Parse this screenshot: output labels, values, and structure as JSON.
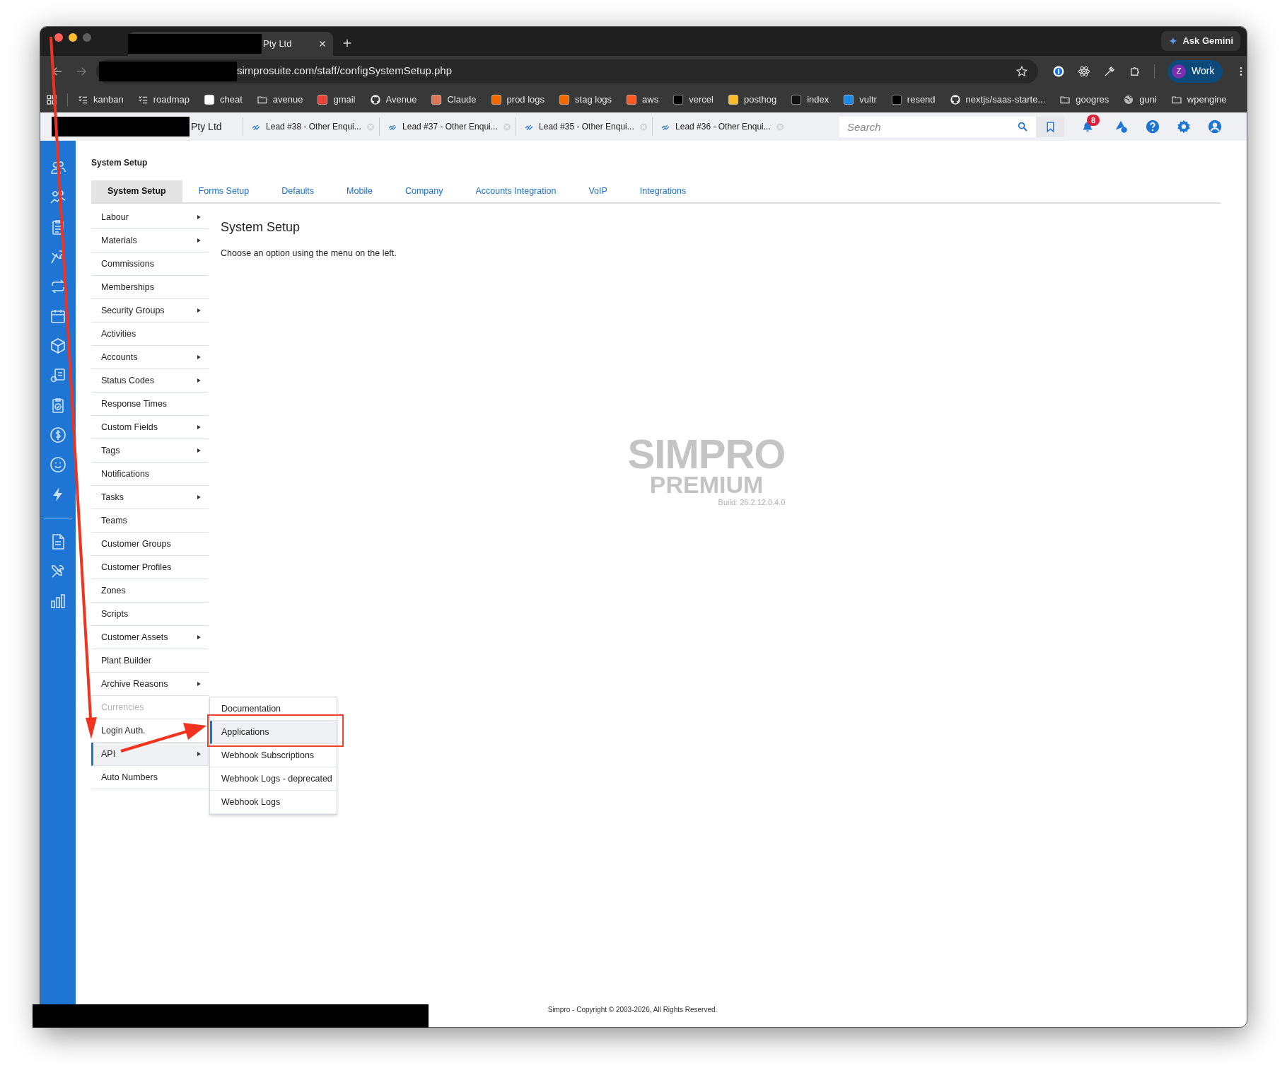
{
  "browser": {
    "tabs": [
      {
        "title": "Pty Ltd",
        "selected": true
      }
    ],
    "gemini": "Ask Gemini",
    "url": "simprosuite.com/staff/configSystemSetup.php",
    "profile": {
      "initial": "Z",
      "label": "Work"
    },
    "bookmarks": [
      {
        "label": "kanban",
        "kind": "checklist"
      },
      {
        "label": "roadmap",
        "kind": "checklist"
      },
      {
        "label": "cheat",
        "kind": "site",
        "color": "#ffffff"
      },
      {
        "label": "avenue",
        "kind": "folder"
      },
      {
        "label": "gmail",
        "kind": "site",
        "color": "#ea4335"
      },
      {
        "label": "Avenue",
        "kind": "github"
      },
      {
        "label": "Claude",
        "kind": "site",
        "color": "#d97757"
      },
      {
        "label": "prod logs",
        "kind": "site",
        "color": "#f46800"
      },
      {
        "label": "stag logs",
        "kind": "site",
        "color": "#f46800"
      },
      {
        "label": "aws",
        "kind": "site",
        "color": "#ff5722"
      },
      {
        "label": "vercel",
        "kind": "site",
        "color": "#000000"
      },
      {
        "label": "posthog",
        "kind": "site",
        "color": "#f9bd2b"
      },
      {
        "label": "index",
        "kind": "site",
        "color": "#111111"
      },
      {
        "label": "vultr",
        "kind": "site",
        "color": "#1e88e5"
      },
      {
        "label": "resend",
        "kind": "site",
        "color": "#000000"
      },
      {
        "label": "nextjs/saas-starte...",
        "kind": "github"
      },
      {
        "label": "googres",
        "kind": "folder"
      },
      {
        "label": "guni",
        "kind": "globe"
      },
      {
        "label": "wpengine",
        "kind": "folder"
      }
    ]
  },
  "app_header": {
    "company": "Pty Ltd",
    "tabs": [
      {
        "label": "Lead #38 - Other Enqui..."
      },
      {
        "label": "Lead #37 - Other Enqui..."
      },
      {
        "label": "Lead #35 - Other Enqui..."
      },
      {
        "label": "Lead #36 - Other Enqui..."
      }
    ],
    "search": {
      "placeholder": "Search"
    },
    "notification_count": "8"
  },
  "breadcrumb": "System Setup",
  "tabs": [
    {
      "label": "System Setup",
      "selected": true
    },
    {
      "label": "Forms Setup",
      "selected": false
    },
    {
      "label": "Defaults",
      "selected": false
    },
    {
      "label": "Mobile",
      "selected": false
    },
    {
      "label": "Company",
      "selected": false
    },
    {
      "label": "Accounts Integration",
      "selected": false
    },
    {
      "label": "VoIP",
      "selected": false
    },
    {
      "label": "Integrations",
      "selected": false
    }
  ],
  "menu": [
    {
      "label": "Labour",
      "has_submenu": true,
      "selected": false,
      "disabled": false
    },
    {
      "label": "Materials",
      "has_submenu": true,
      "selected": false,
      "disabled": false
    },
    {
      "label": "Commissions",
      "has_submenu": false,
      "selected": false,
      "disabled": false
    },
    {
      "label": "Memberships",
      "has_submenu": false,
      "selected": false,
      "disabled": false
    },
    {
      "label": "Security Groups",
      "has_submenu": true,
      "selected": false,
      "disabled": false
    },
    {
      "label": "Activities",
      "has_submenu": false,
      "selected": false,
      "disabled": false
    },
    {
      "label": "Accounts",
      "has_submenu": true,
      "selected": false,
      "disabled": false
    },
    {
      "label": "Status Codes",
      "has_submenu": true,
      "selected": false,
      "disabled": false
    },
    {
      "label": "Response Times",
      "has_submenu": false,
      "selected": false,
      "disabled": false
    },
    {
      "label": "Custom Fields",
      "has_submenu": true,
      "selected": false,
      "disabled": false
    },
    {
      "label": "Tags",
      "has_submenu": true,
      "selected": false,
      "disabled": false
    },
    {
      "label": "Notifications",
      "has_submenu": false,
      "selected": false,
      "disabled": false
    },
    {
      "label": "Tasks",
      "has_submenu": true,
      "selected": false,
      "disabled": false
    },
    {
      "label": "Teams",
      "has_submenu": false,
      "selected": false,
      "disabled": false
    },
    {
      "label": "Customer Groups",
      "has_submenu": false,
      "selected": false,
      "disabled": false
    },
    {
      "label": "Customer Profiles",
      "has_submenu": false,
      "selected": false,
      "disabled": false
    },
    {
      "label": "Zones",
      "has_submenu": false,
      "selected": false,
      "disabled": false
    },
    {
      "label": "Scripts",
      "has_submenu": false,
      "selected": false,
      "disabled": false
    },
    {
      "label": "Customer Assets",
      "has_submenu": true,
      "selected": false,
      "disabled": false
    },
    {
      "label": "Plant Builder",
      "has_submenu": false,
      "selected": false,
      "disabled": false
    },
    {
      "label": "Archive Reasons",
      "has_submenu": true,
      "selected": false,
      "disabled": false
    },
    {
      "label": "Currencies",
      "has_submenu": false,
      "selected": false,
      "disabled": true
    },
    {
      "label": "Login Auth.",
      "has_submenu": false,
      "selected": false,
      "disabled": false
    },
    {
      "label": "API",
      "has_submenu": true,
      "selected": true,
      "disabled": false
    },
    {
      "label": "Auto Numbers",
      "has_submenu": false,
      "selected": false,
      "disabled": false
    }
  ],
  "submenu": [
    {
      "label": "Documentation",
      "selected": false
    },
    {
      "label": "Applications",
      "selected": true
    },
    {
      "label": "Webhook Subscriptions",
      "selected": false
    },
    {
      "label": "Webhook Logs - deprecated",
      "selected": false
    },
    {
      "label": "Webhook Logs",
      "selected": false
    }
  ],
  "content": {
    "title": "System Setup",
    "text": "Choose an option using the menu on the left."
  },
  "logo": {
    "name": "SIMPRO",
    "edition": "PREMIUM",
    "build": "Build: 26.2.12.0.4.0"
  },
  "footer": "Simpro - Copyright © 2003-2026, All Rights Reserved."
}
